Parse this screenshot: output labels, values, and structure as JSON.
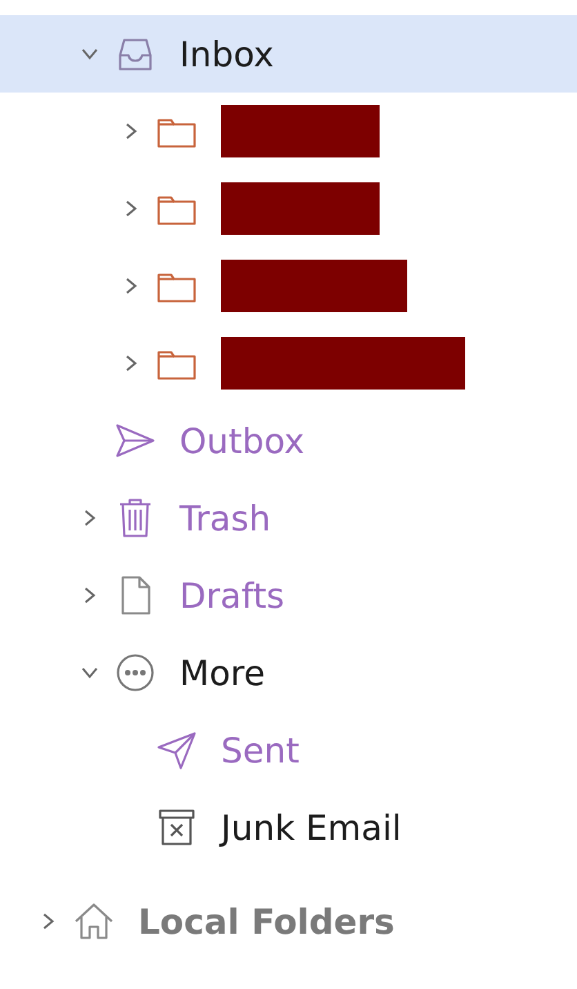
{
  "folders": [
    {
      "label": "Inbox",
      "kind": "inbox",
      "color": "#1c1c1c",
      "selected": true,
      "expanded": true,
      "children": [
        {
          "kind": "redacted-folder",
          "selected": false,
          "expanded": false
        },
        {
          "kind": "redacted-folder",
          "selected": false,
          "expanded": false
        },
        {
          "kind": "redacted-folder",
          "selected": false,
          "expanded": false
        },
        {
          "kind": "redacted-folder",
          "selected": false,
          "expanded": false
        }
      ]
    },
    {
      "label": "Outbox",
      "kind": "outbox",
      "color": "#9a6ac0",
      "selected": false
    },
    {
      "label": "Trash",
      "kind": "trash",
      "color": "#9a6ac0",
      "selected": false,
      "expanded": false
    },
    {
      "label": "Drafts",
      "kind": "drafts",
      "color": "#9a6ac0",
      "selected": false,
      "expanded": false
    },
    {
      "label": "More",
      "kind": "more",
      "color": "#1c1c1c",
      "selected": false,
      "expanded": true,
      "children": [
        {
          "label": "Sent",
          "kind": "sent",
          "color": "#9a6ac0",
          "selected": false
        },
        {
          "label": "Junk Email",
          "kind": "junk",
          "color": "#1c1c1c",
          "selected": false
        }
      ]
    }
  ],
  "account": {
    "label": "Local Folders",
    "kind": "home",
    "expanded": false
  }
}
